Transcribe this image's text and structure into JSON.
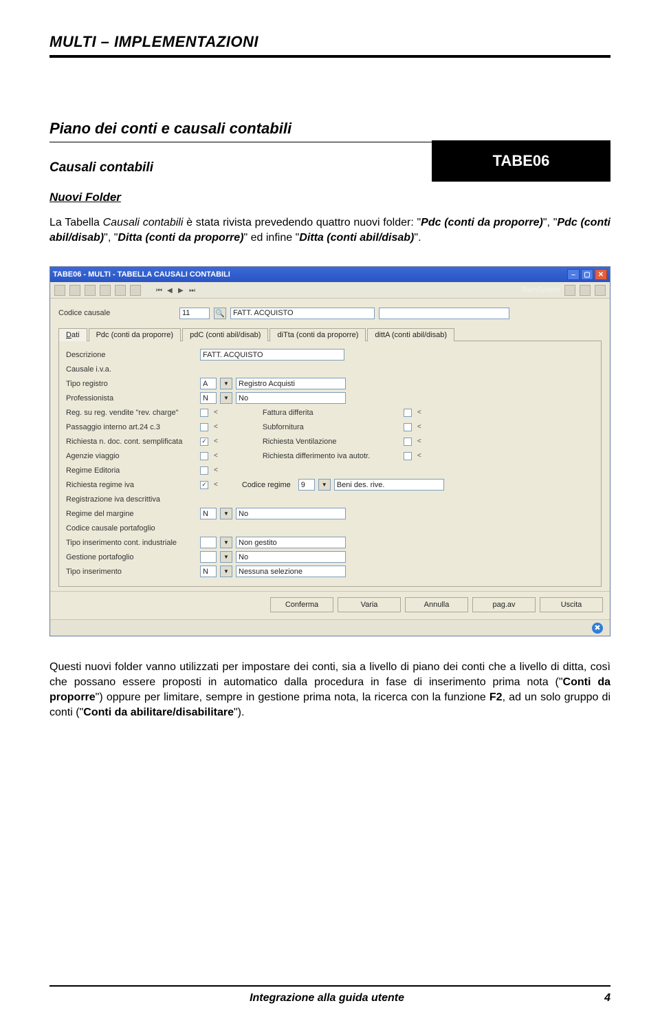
{
  "doc": {
    "header": "MULTI – IMPLEMENTAZIONI",
    "section_title": "Piano dei conti e causali contabili",
    "code": "TABE06",
    "sub1": "Causali contabili",
    "sub2": "Nuovi Folder",
    "para1_a": "La Tabella ",
    "para1_b": "Causali contabili",
    "para1_c": " è stata rivista prevedendo quattro nuovi folder: ",
    "para1_d": "Pdc (conti da proporre)",
    "para1_e": ", ",
    "para1_f": "Pdc (conti abil/disab)",
    "para1_g": ", ",
    "para1_h": "Ditta (conti da proporre)",
    "para1_i": " ed infine ",
    "para1_j": "Ditta (conti abil/disab)",
    "para1_k": ".",
    "para2_a": "Questi nuovi folder vanno utilizzati per impostare dei conti, sia a livello di piano dei conti che a livello di ditta, così che possano essere proposti in automatico dalla procedura in fase di inserimento prima nota (",
    "para2_b": "Conti da proporre",
    "para2_c": ") oppure per limitare, sempre in gestione prima nota, la ricerca con la funzione ",
    "para2_d": "F2",
    "para2_e": ", ad un solo gruppo di conti (",
    "para2_f": "Conti da abilitare/disabilitare",
    "para2_g": ")."
  },
  "screenshot": {
    "title": "TABE06  -  MULTI -  TABELLA CAUSALI CONTABILI",
    "brand": "TeamSystem",
    "codice_label": "Codice causale",
    "codice_value": "11",
    "codice_desc": "FATT. ACQUISTO",
    "tabs": [
      "Dati",
      "Pdc (conti da proporre)",
      "pdC (conti abil/disab)",
      "diTta (conti da proporre)",
      "dittA (conti abil/disab)"
    ],
    "rows": {
      "descrizione_l": "Descrizione",
      "descrizione_v": "FATT. ACQUISTO",
      "causale_iva_l": "Causale i.v.a.",
      "tipo_reg_l": "Tipo registro",
      "tipo_reg_v": "A",
      "tipo_reg_d": "Registro Acquisti",
      "prof_l": "Professionista",
      "prof_v": "N",
      "prof_d": "No",
      "revcharge_l": "Reg. su reg. vendite \"rev. charge\"",
      "fatt_diff_l": "Fattura differita",
      "passaggio_l": "Passaggio interno art.24 c.3",
      "subforn_l": "Subfornitura",
      "richdoc_l": "Richiesta n. doc. cont. semplificata",
      "richvent_l": "Richiesta Ventilazione",
      "agenzie_l": "Agenzie viaggio",
      "richdiff_l": "Richiesta differimento iva autotr.",
      "regedit_l": "Regime Editoria",
      "richregiva_l": "Richiesta regime iva",
      "codregime_l": "Codice regime",
      "codregime_v": "9",
      "codregime_d": "Beni des. rive.",
      "ivadescr_l": "Registrazione iva descrittiva",
      "margine_l": "Regime del margine",
      "margine_v": "N",
      "margine_d": "No",
      "portaf_l": "Codice causale portafoglio",
      "tipoind_l": "Tipo inserimento cont. industriale",
      "tipoind_d": "Non gestito",
      "gestport_l": "Gestione portafoglio",
      "gestport_d": "No",
      "tipoins_l": "Tipo inserimento",
      "tipoins_v": "N",
      "tipoins_d": "Nessuna selezione"
    },
    "buttons": [
      "Conferma",
      "Varia",
      "Annulla",
      "pag.av",
      "Uscita"
    ]
  },
  "footer": {
    "center": "Integrazione alla guida utente",
    "page": "4"
  }
}
